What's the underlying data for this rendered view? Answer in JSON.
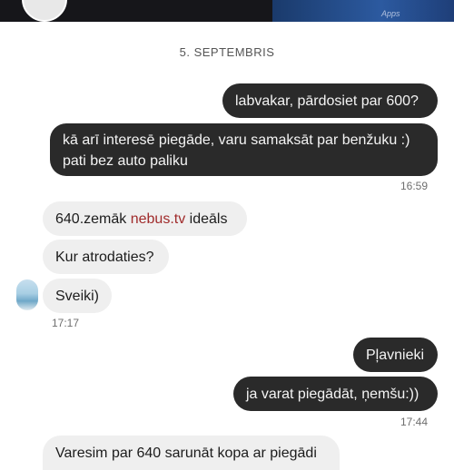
{
  "header": {
    "link_text": "",
    "subtitle": ""
  },
  "date_separator": "5. SEPTEMBRIS",
  "messages": {
    "m1": {
      "text": "labvakar, pārdosiet par 600?"
    },
    "m2": {
      "line1": "kā arī interesē piegāde, varu samaksāt par benžuku :)",
      "line2": "pati bez auto paliku",
      "time": "16:59"
    },
    "m3": {
      "prefix": "640.zemāk ",
      "link": "nebus.tv",
      "suffix": " ideāls"
    },
    "m4": {
      "text": "Kur atrodaties?"
    },
    "m5": {
      "text": "Sveiki)",
      "time": "17:17"
    },
    "m6": {
      "text": "Pļavnieki"
    },
    "m7": {
      "text": "ja varat piegādāt, ņemšu:))",
      "time": "17:44"
    },
    "m8": {
      "text": "Varesim par 640 sarunāt kopa ar piegādi"
    }
  }
}
